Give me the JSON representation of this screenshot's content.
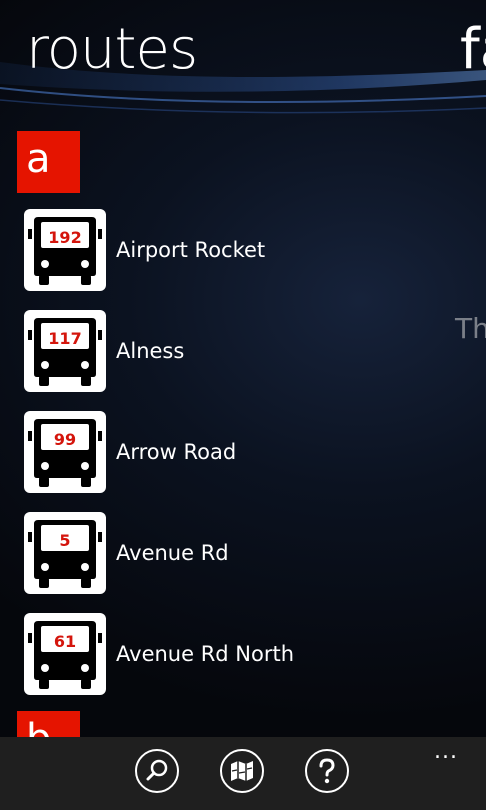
{
  "header": {
    "title": "routes",
    "next_pivot_fragment": "fa"
  },
  "peek_text": "Th",
  "groups": [
    {
      "letter": "a",
      "routes": [
        {
          "number": "192",
          "name": "Airport Rocket"
        },
        {
          "number": "117",
          "name": "Alness"
        },
        {
          "number": "99",
          "name": "Arrow Road"
        },
        {
          "number": "5",
          "name": "Avenue Rd"
        },
        {
          "number": "61",
          "name": "Avenue Rd North"
        }
      ]
    },
    {
      "letter": "b",
      "routes": []
    }
  ],
  "app_bar": {
    "buttons": [
      {
        "icon": "search-icon"
      },
      {
        "icon": "map-icon"
      },
      {
        "icon": "help-icon"
      }
    ],
    "more": "..."
  },
  "colors": {
    "accent": "#e51400",
    "route_number": "#d4150c",
    "app_bar": "#1f1f1f"
  }
}
